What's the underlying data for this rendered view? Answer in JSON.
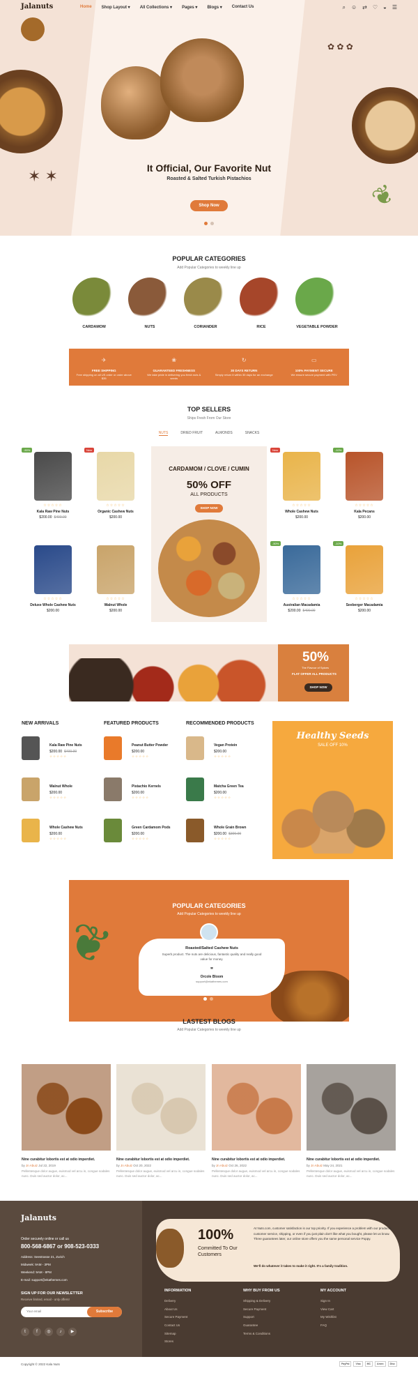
{
  "header": {
    "logo": "Jalanuts",
    "nav": [
      "Home",
      "Shop Layout",
      "All Collections",
      "Pages",
      "Blogs",
      "Contact Us"
    ],
    "icons": [
      "search-icon",
      "user-icon",
      "compare-icon",
      "wishlist-icon",
      "cart-icon",
      "menu-icon"
    ]
  },
  "hero": {
    "title": "It Official, Our Favorite Nut",
    "subtitle": "Roasted & Salted Turkish Pistachios",
    "button": "Shop Now"
  },
  "popular": {
    "title": "POPULAR CATEGORIES",
    "subtitle": "Add Popular Categories to weekly line up",
    "items": [
      {
        "label": "CARDAMOM",
        "color": "#7a8a3a"
      },
      {
        "label": "NUTS",
        "color": "#8a5a3a"
      },
      {
        "label": "CORIANDER",
        "color": "#9a8a4a"
      },
      {
        "label": "RICE",
        "color": "#a6462a"
      },
      {
        "label": "VEGETABLE POWDER",
        "color": "#6aa84a"
      }
    ]
  },
  "features": [
    {
      "icon": "plane-icon",
      "title": "FREE SHIPPING",
      "desc": "Free shipping on all US order or order above $35"
    },
    {
      "icon": "leaf-icon",
      "title": "GUARANTEED FRESHNESS",
      "desc": "We take pride in delivering you fresh nuts & seeds"
    },
    {
      "icon": "return-icon",
      "title": "30 DAYS RETURN",
      "desc": "Simply return it within 30 days for an exchange"
    },
    {
      "icon": "card-icon",
      "title": "100% PAYMENT SECURE",
      "desc": "We ensure secure payment with PEV"
    }
  ],
  "topsellers": {
    "title": "TOP SELLERS",
    "subtitle": "Ships Fresh From Our Store",
    "tabs": [
      "NUTS",
      "DRIED FRUIT",
      "ALMONDS",
      "SNACKS"
    ],
    "products": [
      {
        "name": "Kala Raw Pine Nuts",
        "price": "$200.00",
        "old": "$400.00",
        "tag": "-50%",
        "tagc": "#6aa84a",
        "c": "#4a4a4a"
      },
      {
        "name": "Organic Cashew Nuts",
        "price": "$200.00",
        "old": "",
        "tag": "New",
        "tagc": "#d9453a",
        "c": "#e8d8a8"
      },
      {
        "name": "Whole Cashew Nuts",
        "price": "$200.00",
        "old": "",
        "tag": "New",
        "tagc": "#d9453a",
        "c": "#e9b44a"
      },
      {
        "name": "Kala Pecans",
        "price": "$200.00",
        "old": "",
        "tag": "-10%",
        "tagc": "#6aa84a",
        "c": "#b8542a"
      },
      {
        "name": "Deluxe Whole Cashew Nuts",
        "price": "$200.00",
        "old": "",
        "tag": "",
        "tagc": "",
        "c": "#2a4a8a"
      },
      {
        "name": "Walnut Whole",
        "price": "$200.00",
        "old": "",
        "tag": "",
        "tagc": "",
        "c": "#c9a46a"
      },
      {
        "name": "Australian Macadamia",
        "price": "$200.00",
        "old": "$400.00",
        "tag": "-50%",
        "tagc": "#6aa84a",
        "c": "#3a6a9a"
      },
      {
        "name": "Seeberger Macadamia",
        "price": "$200.00",
        "old": "",
        "tag": "-10%",
        "tagc": "#6aa84a",
        "c": "#e9a23a"
      }
    ],
    "promo": {
      "title": "CARDAMOM / CLOVE / CUMIN",
      "off": "50% OFF",
      "sub": "ALL PRODUCTS",
      "btn": "SHOP NOW"
    }
  },
  "banner2": {
    "big": "50%",
    "l1": "The Flavour of Spices",
    "l2": "FLAT OFFER ALL PRODUCTS",
    "btn": "SHOP NOW"
  },
  "lists": [
    {
      "title": "NEW ARRIVALS",
      "items": [
        {
          "n": "Kala Raw Pine Nuts",
          "p": "$200.00",
          "o": "$400.00",
          "c": "#555"
        },
        {
          "n": "Walnut Whole",
          "p": "$200.00",
          "o": "",
          "c": "#c9a46a"
        },
        {
          "n": "Whole Cashew Nuts",
          "p": "$200.00",
          "o": "",
          "c": "#e9b44a"
        }
      ]
    },
    {
      "title": "FEATURED PRODUCTS",
      "items": [
        {
          "n": "Peanut Butter Powder",
          "p": "$200.00",
          "o": "",
          "c": "#e97a2a"
        },
        {
          "n": "Pistachio Kernels",
          "p": "$200.00",
          "o": "",
          "c": "#8a7a6a"
        },
        {
          "n": "Green Cardamom Pods",
          "p": "$200.00",
          "o": "",
          "c": "#6a8a3a"
        }
      ]
    },
    {
      "title": "RECOMMENDED PRODUCTS",
      "items": [
        {
          "n": "Vegan Protein",
          "p": "$200.00",
          "o": "",
          "c": "#d9b88a"
        },
        {
          "n": "Matcha Green Tea",
          "p": "$200.00",
          "o": "",
          "c": "#3a7a4a"
        },
        {
          "n": "Whole Grain Brown",
          "p": "$200.00",
          "o": "$300.00",
          "c": "#8a5a2a"
        }
      ]
    }
  ],
  "healthy": {
    "title": "Healthy Seeds",
    "off": "SALE OFF 10%"
  },
  "testimonial": {
    "title": "POPULAR CATEGORIES",
    "subtitle": "Add Popular Categories to weekly line up",
    "product": "Roasted/Salted Cashew Nuts",
    "quote": "Superb product. The nuts are delicious, fantastic quality and really good value for money.",
    "author": "Orcole Bloom",
    "email": "support@ekathemes.com"
  },
  "blogs": {
    "title": "LASTEST BLOGS",
    "subtitle": "Add Popular Categories to weekly line up",
    "items": [
      {
        "t": "Nine curabitur lobortis est at odio imperdiet.",
        "by": "Jn Abuiz",
        "d": "Jul 22, 2019",
        "x": "Pellentesque dolor augue, euismod vel arcu in, congue sodales nunc. Duis sed auctor dolor, ac...",
        "c": "#8a4a1a"
      },
      {
        "t": "Nine curabitur lobortis est at odio imperdiet.",
        "by": "Jn Abuiz",
        "d": "Oct 20, 2022",
        "x": "Pellentesque dolor augue, euismod vel arcu in, congue sodales nunc. Duis sed auctor dolor, ac...",
        "c": "#d8c8b0"
      },
      {
        "t": "Nine curabitur lobortis est at odio imperdiet.",
        "by": "Jn Abuiz",
        "d": "Oct 26, 2022",
        "x": "Pellentesque dolor augue, euismod vel arcu in, congue sodales nunc. Duis sed auctor dolor, ac...",
        "c": "#c87a4a"
      },
      {
        "t": "Nine curabitur lobortis est at odio imperdiet.",
        "by": "Jn Abuiz",
        "d": "May 24, 2021",
        "x": "Pellentesque dolor augue, euismod vel arcu in, congue sodales nunc. Duis sed auctor dolor, ac...",
        "c": "#5a5048"
      }
    ]
  },
  "footer": {
    "order": "Order securely online or call us",
    "phone": "800-568-6867 or 908-523-0333",
    "address": "Address: Seestrasse 21, Zurich",
    "midweek": "Midweek: 9AM - 3PM",
    "weekend": "Weekend: 9AM - 8PM",
    "email": "E-mail: support@ekathemes.com",
    "news": "SIGN UP FOR OUR NEWSLETTER",
    "news_sub": "Receive limited, email - only offers!",
    "placeholder": "Your email",
    "subscribe": "Subscribe",
    "hundred": "100%",
    "committed": "Committed To Our Customers",
    "commit_txt": "At Nuts.com, customer satisfaction is our top priority. If you experience a problem with our products, customer service, shipping, or even if you just plain don't like what you bought, please let us know. Three guarantees later, our online store offers you the same personal service Poppy.",
    "commit_b": "We'll do whatever it takes to make it right. It's a family tradition.",
    "cols": [
      {
        "h": "INFORMATION",
        "items": [
          "Delivery",
          "About Us",
          "Secure Payment",
          "Contact Us",
          "Sitemap",
          "Stores"
        ]
      },
      {
        "h": "WHY BUY FROM US",
        "items": [
          "Shipping & Delivery",
          "Secure Payment",
          "Support",
          "Guarantee",
          "Terms & Conditions"
        ]
      },
      {
        "h": "MY ACCOUNT",
        "items": [
          "Sign In",
          "View Cart",
          "My Wishlist",
          "FAQ"
        ]
      }
    ],
    "copy": "Copyright © 2022 Kala Nuts",
    "pay": [
      "PayPal",
      "Visa",
      "MC",
      "Amex",
      "Disc"
    ]
  }
}
